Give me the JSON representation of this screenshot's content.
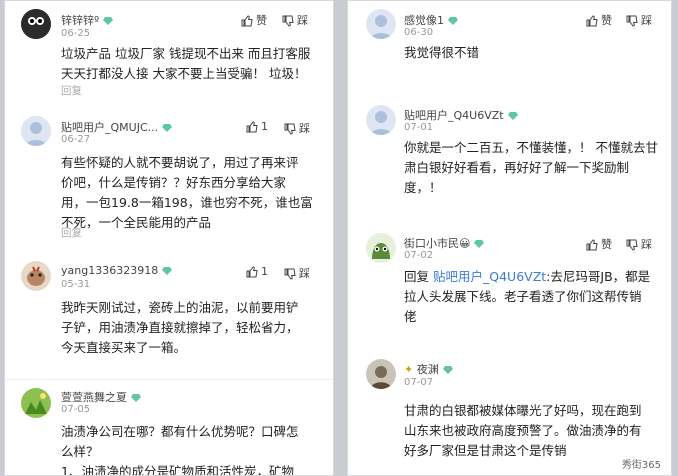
{
  "actions": {
    "like": "赞",
    "dislike": "踩",
    "reply": "回复"
  },
  "left": [
    {
      "user": "锌锌锌º",
      "date": "06-25",
      "like_count": "",
      "lines": [
        "垃圾产品 垃圾厂家 钱提现不出来 而且打客服",
        "天天打都没人接 大家不要上当受骗！ 垃圾！"
      ]
    },
    {
      "user": "贴吧用户_QMUJC...",
      "date": "06-27",
      "like_count": "1",
      "lines": [
        "有些怀疑的人就不要胡说了，用过了再来评",
        "价吧，什么是传销？？好东西分享给大家",
        "用，一包19.8一箱198，谁也穷不死，谁也富",
        "不死，一个全民能用的产品"
      ]
    },
    {
      "user": "yang1336323918",
      "date": "05-31",
      "like_count": "1",
      "lines": [
        "我昨天刚试过，瓷砖上的油泥，以前要用铲",
        "子铲，用油渍净直接就擦掉了，轻松省力，",
        "今天直接买来了一箱。"
      ]
    },
    {
      "user": "萱萱燕舞之夏",
      "date": "07-05",
      "like_count": "",
      "lines": [
        "油渍净公司在哪？都有什么优势呢？口碑怎",
        "么样？",
        "1、油渍净的成分是矿物质和活性炭，矿物"
      ]
    }
  ],
  "right": [
    {
      "user": "感觉像1",
      "date": "06-30",
      "like_count": "",
      "lines": [
        "我觉得很不错"
      ]
    },
    {
      "user": "贴吧用户_Q4U6VZt",
      "date": "07-01",
      "like_count": "",
      "lines": [
        "你就是一个二百五，不懂装懂，！ 不懂就去甘",
        "肃白银好好看看，再好好了解一下奖励制",
        "度，！"
      ]
    },
    {
      "user": "街口小市民😀",
      "date": "07-02",
      "like_count": "",
      "reply_to": "贴吧用户_Q4U6VZt",
      "lines": [
        ":去尼玛哥JB，都是",
        "拉人头发展下线。老子看透了你们这帮传销",
        "佬"
      ]
    },
    {
      "user": "夜渊",
      "date": "07-07",
      "like_count": "",
      "lines": [
        "甘肃的白银都被媒体曝光了好吗，现在跑到",
        "山东来也被政府高度预警了。做油渍净的有",
        "好多厂家但是甘肃这个是传销"
      ]
    }
  ],
  "colors": {
    "badge": "#5fc5a8",
    "link": "#3a7bd5"
  },
  "watermark": "秀街365"
}
